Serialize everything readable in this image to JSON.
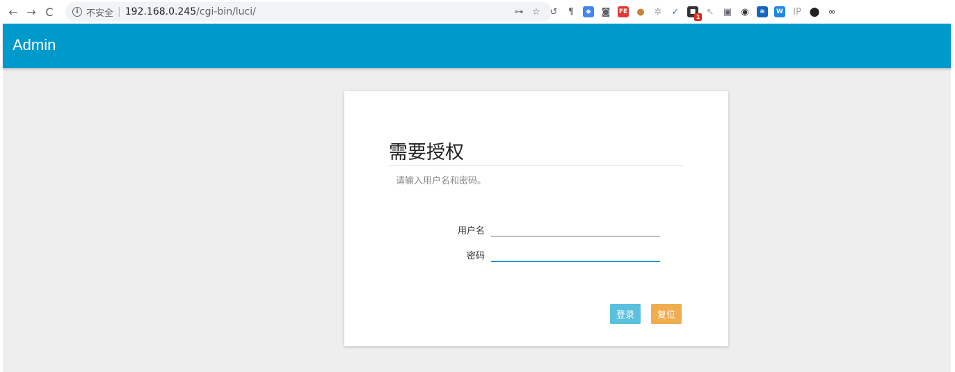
{
  "browser": {
    "nav": {
      "back": "←",
      "forward": "→",
      "reload": "C"
    },
    "address": {
      "insecure_label": "不安全",
      "host": "192.168.0.245",
      "path": "/cgi-bin/luci/"
    },
    "extensions": [
      {
        "name": "key-icon",
        "glyph": "⊶",
        "color": "#5f6368"
      },
      {
        "name": "star-icon",
        "glyph": "☆",
        "color": "#5f6368"
      },
      {
        "name": "history-icon",
        "glyph": "↺",
        "color": "#5f6368"
      },
      {
        "name": "pilcrow-icon",
        "glyph": "¶",
        "color": "#5f6368"
      },
      {
        "name": "translate-icon",
        "glyph": "◆",
        "color": "#4285f4"
      },
      {
        "name": "camera-icon",
        "glyph": "◙",
        "color": "#5f6368"
      },
      {
        "name": "fe-icon",
        "glyph": "FE",
        "color": "#e53935"
      },
      {
        "name": "cookie-icon",
        "glyph": "●",
        "color": "#c8823a"
      },
      {
        "name": "gear-icon",
        "glyph": "✲",
        "color": "#9e9e9e"
      },
      {
        "name": "check-circle-icon",
        "glyph": "✓",
        "color": "#1a73e8"
      },
      {
        "name": "puzzle-icon",
        "glyph": "■",
        "color": "#333333"
      },
      {
        "name": "cursor-icon",
        "glyph": "↖",
        "color": "#9e9e9e"
      },
      {
        "name": "image-icon",
        "glyph": "▣",
        "color": "#5f6368"
      },
      {
        "name": "eye-icon",
        "glyph": "◉",
        "color": "#333333"
      },
      {
        "name": "wave-icon",
        "glyph": "≋",
        "color": "#1565c0"
      },
      {
        "name": "w-icon",
        "glyph": "W",
        "color": "#1e88e5"
      },
      {
        "name": "ip-icon",
        "glyph": "IP",
        "color": "#9e9e9e"
      },
      {
        "name": "circle-icon",
        "glyph": "⬤",
        "color": "#202124"
      },
      {
        "name": "mask-icon",
        "glyph": "∞",
        "color": "#202124"
      }
    ],
    "badge_count": "1"
  },
  "header": {
    "brand": "Admin",
    "color": "#0099cc"
  },
  "login": {
    "title": "需要授权",
    "description": "请输入用户名和密码。",
    "username_label": "用户名",
    "username_value": "",
    "password_label": "密码",
    "password_value": "",
    "login_button": "登录",
    "reset_button": "复位",
    "login_color": "#5bc0de",
    "reset_color": "#f0ad4e"
  }
}
